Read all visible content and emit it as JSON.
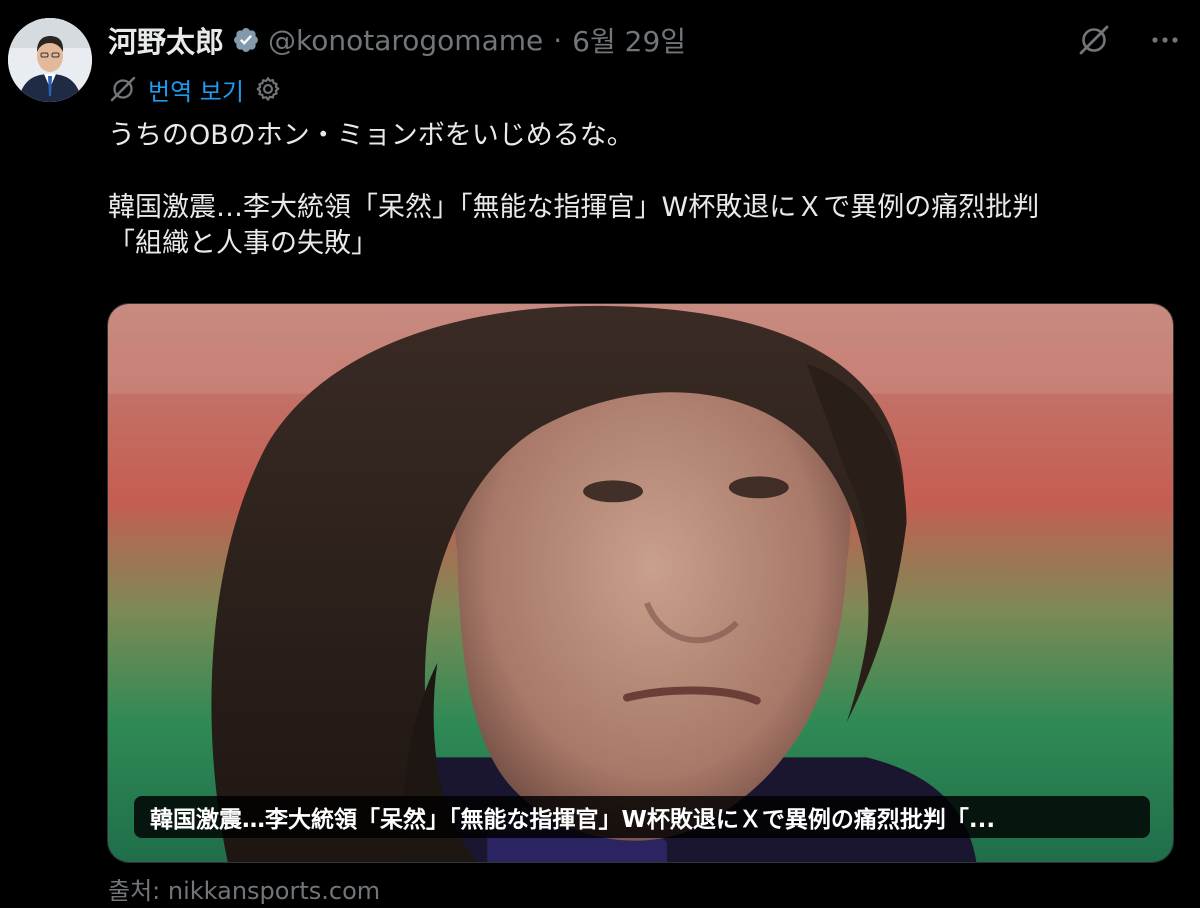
{
  "author": {
    "display_name": "河野太郎",
    "handle": "@konotarogomame",
    "separator": "·",
    "date": "6월 29일"
  },
  "icons": {
    "verified": "verified-badge-icon",
    "grok": "grok-icon",
    "more": "more-options-icon",
    "settings": "gear-icon"
  },
  "translate": {
    "label": "번역 보기"
  },
  "tweet": {
    "line1": "うちのOBのホン・ミョンボをいじめるな。",
    "line2": "韓国激震…李大統領「呆然」「無能な指揮官」W杯敗退にＸで異例の痛烈批判",
    "line3": "「組織と人事の失敗」"
  },
  "card": {
    "caption": "韓国激震…李大統領「呆然」「無能な指揮官」W杯敗退にＸで異例の痛烈批判「..."
  },
  "source": {
    "text": "출처: nikkansports.com"
  },
  "colors": {
    "background": "#000000",
    "text": "#e7e9ea",
    "secondary": "#71767b",
    "link": "#1d9bf0"
  }
}
